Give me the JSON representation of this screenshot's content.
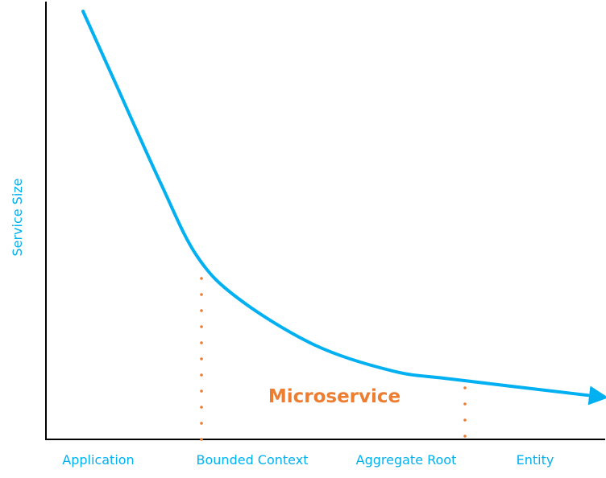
{
  "chart_data": {
    "type": "line",
    "title": "",
    "xlabel": "",
    "ylabel": "Service Size",
    "x_categories": [
      "Application",
      "Bounded Context",
      "Aggregate Root",
      "Entity"
    ],
    "series": [
      {
        "name": "Service Size curve",
        "description": "Monotonically decreasing curve, steep at Application and flattening toward Entity, ending in an arrow",
        "points_normalized": [
          {
            "x": 0.0,
            "y": 1.0
          },
          {
            "x": 0.06,
            "y": 0.84
          },
          {
            "x": 0.15,
            "y": 0.6
          },
          {
            "x": 0.22,
            "y": 0.43
          },
          {
            "x": 0.3,
            "y": 0.33
          },
          {
            "x": 0.45,
            "y": 0.22
          },
          {
            "x": 0.6,
            "y": 0.16
          },
          {
            "x": 0.72,
            "y": 0.14
          },
          {
            "x": 1.0,
            "y": 0.1
          }
        ]
      }
    ],
    "annotations": [
      {
        "type": "vertical-dotted-line",
        "at": "Bounded Context",
        "color": "#ed7d31"
      },
      {
        "type": "vertical-dotted-line",
        "at": "Aggregate Root",
        "color": "#ed7d31"
      },
      {
        "type": "text",
        "text": "Microservice",
        "between": [
          "Bounded Context",
          "Aggregate Root"
        ],
        "color": "#ed7d31"
      }
    ],
    "grid": false,
    "legend": "none"
  },
  "colors": {
    "curve": "#00b0f0",
    "labels": "#00b0f0",
    "annotation": "#ed7d31",
    "axes": "#000000"
  },
  "labels": {
    "y_axis": "Service Size",
    "x_ticks": [
      "Application",
      "Bounded Context",
      "Aggregate Root",
      "Entity"
    ],
    "region": "Microservice"
  }
}
